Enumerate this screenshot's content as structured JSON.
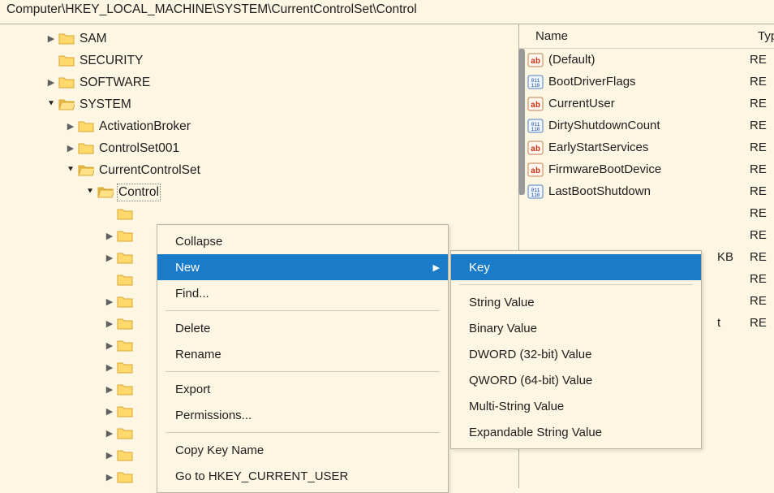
{
  "address": "Computer\\HKEY_LOCAL_MACHINE\\SYSTEM\\CurrentControlSet\\Control",
  "tree": {
    "items": {
      "sam": "SAM",
      "security": "SECURITY",
      "software": "SOFTWARE",
      "system": "SYSTEM",
      "activationbroker": "ActivationBroker",
      "controlset001": "ControlSet001",
      "currentcontrolset": "CurrentControlSet",
      "control": "Control"
    }
  },
  "list": {
    "header": {
      "name": "Name",
      "type": "Typ"
    },
    "rows": [
      {
        "icon": "ab",
        "name": "(Default)",
        "type": "RE",
        "extra": ""
      },
      {
        "icon": "bin",
        "name": "BootDriverFlags",
        "type": "RE",
        "extra": ""
      },
      {
        "icon": "ab",
        "name": "CurrentUser",
        "type": "RE",
        "extra": ""
      },
      {
        "icon": "bin",
        "name": "DirtyShutdownCount",
        "type": "RE",
        "extra": ""
      },
      {
        "icon": "ab",
        "name": "EarlyStartServices",
        "type": "RE",
        "extra": ""
      },
      {
        "icon": "ab",
        "name": "FirmwareBootDevice",
        "type": "RE",
        "extra": ""
      },
      {
        "icon": "bin",
        "name": "LastBootShutdown",
        "type": "RE",
        "extra": ""
      },
      {
        "icon": "",
        "name": "",
        "type": "RE",
        "extra": ""
      },
      {
        "icon": "",
        "name": "",
        "type": "RE",
        "extra": ""
      },
      {
        "icon": "",
        "name": "",
        "type": "RE",
        "extra": "KB"
      },
      {
        "icon": "",
        "name": "",
        "type": "RE",
        "extra": ""
      },
      {
        "icon": "",
        "name": "",
        "type": "RE",
        "extra": ""
      },
      {
        "icon": "",
        "name": "",
        "type": "RE",
        "extra": "t"
      }
    ]
  },
  "ctx_main": [
    {
      "label": "Collapse",
      "sub": false,
      "hl": false
    },
    {
      "label": "New",
      "sub": true,
      "hl": true
    },
    {
      "label": "Find...",
      "sub": false,
      "hl": false
    },
    {
      "sep": true
    },
    {
      "label": "Delete",
      "sub": false,
      "hl": false
    },
    {
      "label": "Rename",
      "sub": false,
      "hl": false
    },
    {
      "sep": true
    },
    {
      "label": "Export",
      "sub": false,
      "hl": false
    },
    {
      "label": "Permissions...",
      "sub": false,
      "hl": false
    },
    {
      "sep": true
    },
    {
      "label": "Copy Key Name",
      "sub": false,
      "hl": false
    },
    {
      "label": "Go to HKEY_CURRENT_USER",
      "sub": false,
      "hl": false
    }
  ],
  "ctx_sub": [
    {
      "label": "Key",
      "hl": true
    },
    {
      "sep": true
    },
    {
      "label": "String Value",
      "hl": false
    },
    {
      "label": "Binary Value",
      "hl": false
    },
    {
      "label": "DWORD (32-bit) Value",
      "hl": false
    },
    {
      "label": "QWORD (64-bit) Value",
      "hl": false
    },
    {
      "label": "Multi-String Value",
      "hl": false
    },
    {
      "label": "Expandable String Value",
      "hl": false
    }
  ]
}
